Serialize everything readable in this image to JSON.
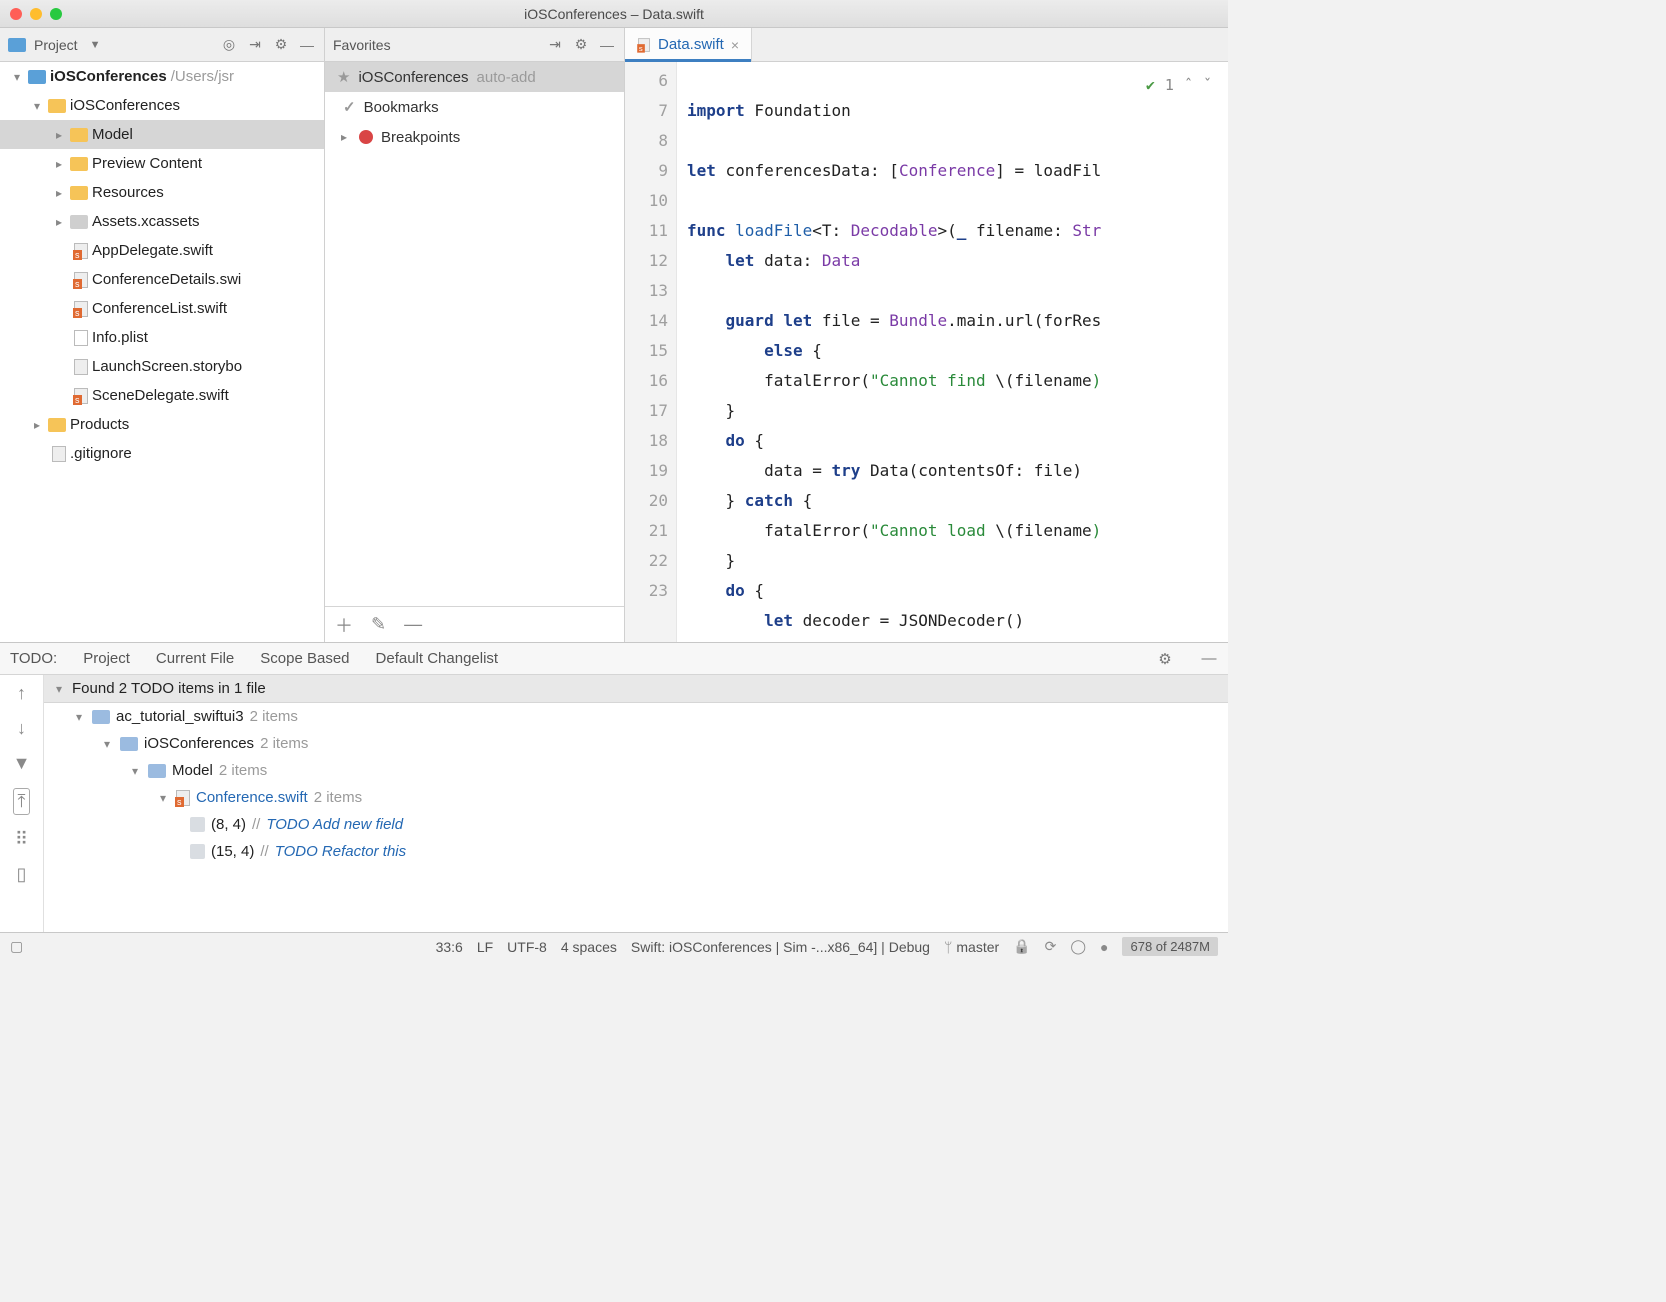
{
  "window": {
    "title": "iOSConferences – Data.swift"
  },
  "project_panel": {
    "label": "Project",
    "root_name": "iOSConferences",
    "root_path": "/Users/jsr",
    "tree": {
      "group": "iOSConferences",
      "model": "Model",
      "preview": "Preview Content",
      "resources": "Resources",
      "assets": "Assets.xcassets",
      "appdelegate": "AppDelegate.swift",
      "confdetails": "ConferenceDetails.swi",
      "conflist": "ConferenceList.swift",
      "infoplist": "Info.plist",
      "launchscreen": "LaunchScreen.storybo",
      "scenedel": "SceneDelegate.swift",
      "products": "Products",
      "gitignore": ".gitignore"
    }
  },
  "favorites_panel": {
    "label": "Favorites",
    "item1_name": "iOSConferences",
    "item1_note": "auto-add",
    "item2": "Bookmarks",
    "item3": "Breakpoints"
  },
  "editor": {
    "tab_name": "Data.swift",
    "highlight_count": "1",
    "gutter_start": 6,
    "gutter_end": 23,
    "lines": {
      "l6": {
        "a": "import",
        "b": " Foundation"
      },
      "l7": "",
      "l8": {
        "a": "let",
        "b": " conferencesData: [",
        "c": "Conference",
        "d": "] = loadFil"
      },
      "l9": "",
      "l10": {
        "a": "func",
        "b": " ",
        "c": "loadFile",
        "d": "<T: ",
        "e": "Decodable",
        "f": ">(",
        "g": "_",
        "h": " filename: ",
        "i": "Str"
      },
      "l11": {
        "a": "    let",
        "b": " data: ",
        "c": "Data"
      },
      "l12": "",
      "l13": {
        "a": "    guard let",
        "b": " file = ",
        "c": "Bundle",
        "d": ".main.url(forRes"
      },
      "l14": {
        "a": "        else",
        "b": " {"
      },
      "l15": {
        "a": "        fatalError(",
        "b": "\"Cannot find ",
        "c": "\\(",
        "d": "filename",
        "e": ")"
      },
      "l16": "    }",
      "l17": {
        "a": "    do",
        "b": " {"
      },
      "l18": {
        "a": "        data = ",
        "b": "try",
        "c": " Data(contentsOf: file)"
      },
      "l19": {
        "a": "    } ",
        "b": "catch",
        "c": " {"
      },
      "l20": {
        "a": "        fatalError(",
        "b": "\"Cannot load ",
        "c": "\\(",
        "d": "filename",
        "e": ")"
      },
      "l21": "    }",
      "l22": {
        "a": "    do",
        "b": " {"
      },
      "l23": {
        "a": "        let",
        "b": " decoder = JSONDecoder()"
      }
    }
  },
  "todo": {
    "tab_label": "TODO:",
    "tabs": {
      "t1": "Project",
      "t2": "Current File",
      "t3": "Scope Based",
      "t4": "Default Changelist"
    },
    "summary": "Found 2 TODO items in 1 file",
    "tree": {
      "d1_name": "ac_tutorial_swiftui3",
      "d1_count": "2 items",
      "d2_name": "iOSConferences",
      "d2_count": "2 items",
      "d3_name": "Model",
      "d3_count": "2 items",
      "f_name": "Conference.swift",
      "f_count": "2 items",
      "i1_loc": "(8, 4)",
      "i1_sep": "//",
      "i1_text": "TODO Add new field",
      "i2_loc": "(15, 4)",
      "i2_sep": "//",
      "i2_text": "TODO Refactor this"
    }
  },
  "status": {
    "pos": "33:6",
    "eol": "LF",
    "enc": "UTF-8",
    "indent": "4 spaces",
    "config": "Swift: iOSConferences | Sim -...x86_64] | Debug",
    "branch": "master",
    "mem": "678 of 2487M"
  }
}
